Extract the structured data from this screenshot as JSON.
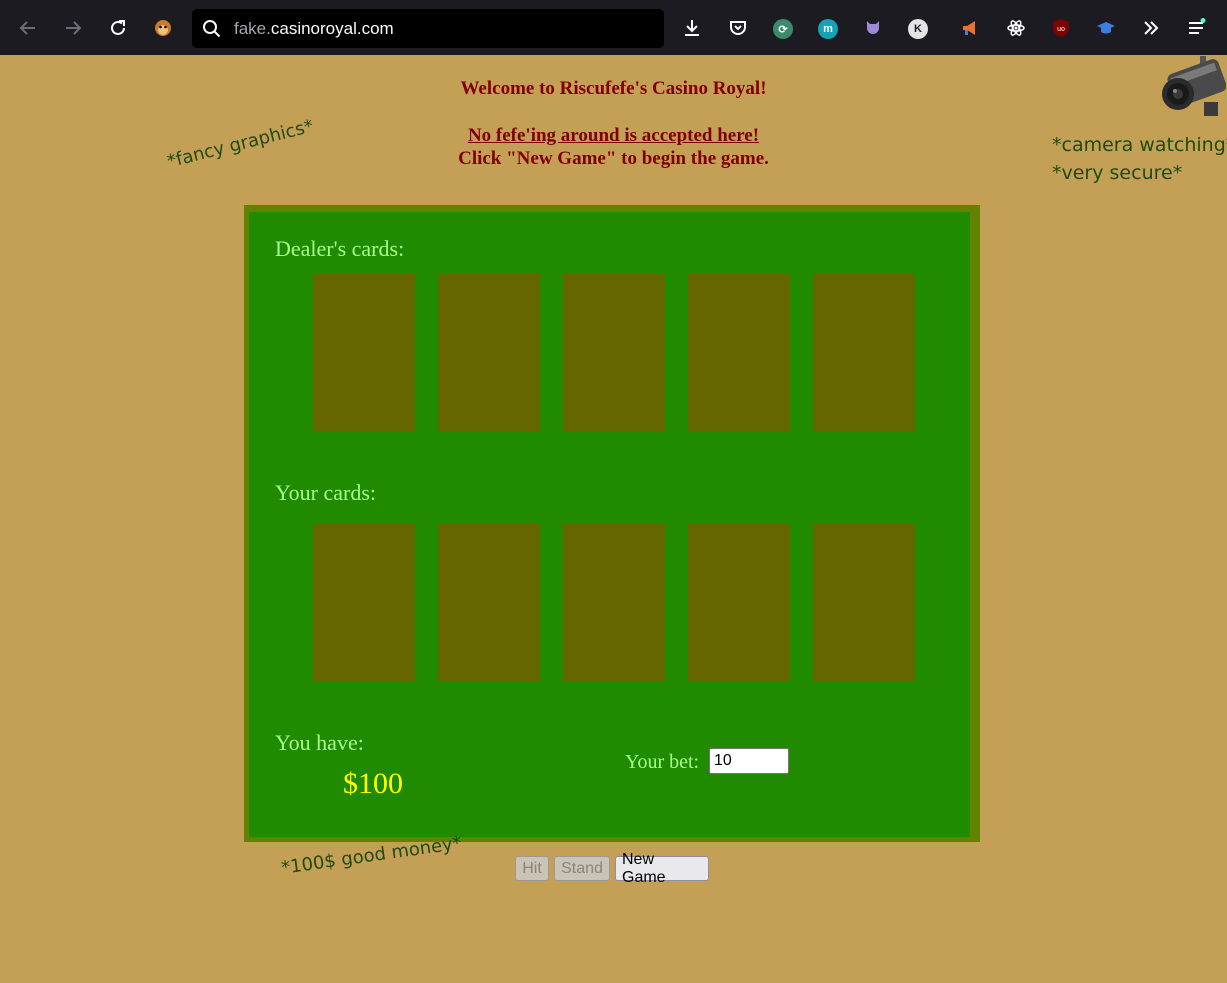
{
  "browser": {
    "url_subdomain": "fake.",
    "url_domain": "casinoroyal.com",
    "ext_k_label": "K",
    "ext_m_label": "m"
  },
  "page": {
    "welcome": "Welcome to Riscufefe's Casino Royal!",
    "warning": "No fefe'ing around is accepted here!",
    "instruction": "Click \"New Game\" to begin the game.",
    "note_fancy": "*fancy graphics*",
    "note_camera": "*camera watching*",
    "note_secure": "*very secure*",
    "note_money": "*100$ good money*"
  },
  "game": {
    "dealer_label": "Dealer's cards:",
    "player_label": "Your cards:",
    "you_have_label": "You have:",
    "money": "$100",
    "bet_label": "Your bet:",
    "bet_value": "10"
  },
  "buttons": {
    "hit": "Hit",
    "stand": "Stand",
    "new_game": "New Game"
  },
  "colors": {
    "page_bg": "#c4a056",
    "felt": "#208a00",
    "table_border": "#638200",
    "card_back": "#666600",
    "heading": "#800000",
    "label": "#a5ff8f",
    "money": "#ffff00"
  }
}
